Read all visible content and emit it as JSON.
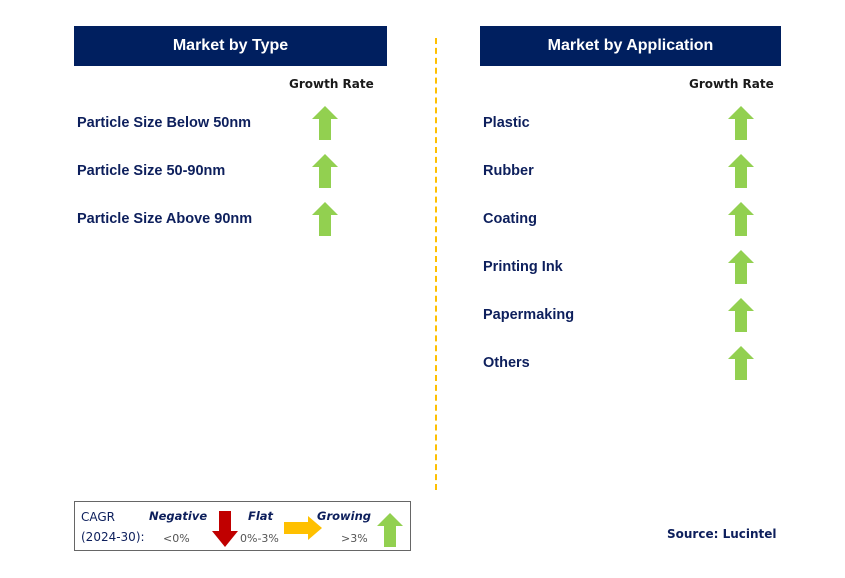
{
  "colors": {
    "header_bg": "#001F5F",
    "label_text": "#0d1f5c",
    "growing_arrow": "#92D050",
    "negative_arrow": "#C00000",
    "flat_arrow": "#FFC000",
    "divider": "#FFC000"
  },
  "type_panel": {
    "title": "Market by Type",
    "growth_rate_label": "Growth Rate",
    "items": [
      {
        "label": "Particle Size Below 50nm",
        "trend": "growing",
        "icon": "up-arrow-icon"
      },
      {
        "label": "Particle Size 50-90nm",
        "trend": "growing",
        "icon": "up-arrow-icon"
      },
      {
        "label": "Particle Size Above 90nm",
        "trend": "growing",
        "icon": "up-arrow-icon"
      }
    ]
  },
  "application_panel": {
    "title": "Market by Application",
    "growth_rate_label": "Growth Rate",
    "items": [
      {
        "label": "Plastic",
        "trend": "growing",
        "icon": "up-arrow-icon"
      },
      {
        "label": "Rubber",
        "trend": "growing",
        "icon": "up-arrow-icon"
      },
      {
        "label": "Coating",
        "trend": "growing",
        "icon": "up-arrow-icon"
      },
      {
        "label": "Printing Ink",
        "trend": "growing",
        "icon": "up-arrow-icon"
      },
      {
        "label": "Papermaking",
        "trend": "growing",
        "icon": "up-arrow-icon"
      },
      {
        "label": "Others",
        "trend": "growing",
        "icon": "up-arrow-icon"
      }
    ]
  },
  "legend": {
    "cagr_line1": "CAGR",
    "cagr_line2": "(2024-30):",
    "negative_label": "Negative",
    "negative_range": "<0%",
    "flat_label": "Flat",
    "flat_range": "0%-3%",
    "growing_label": "Growing",
    "growing_range": ">3%"
  },
  "source": "Source: Lucintel"
}
